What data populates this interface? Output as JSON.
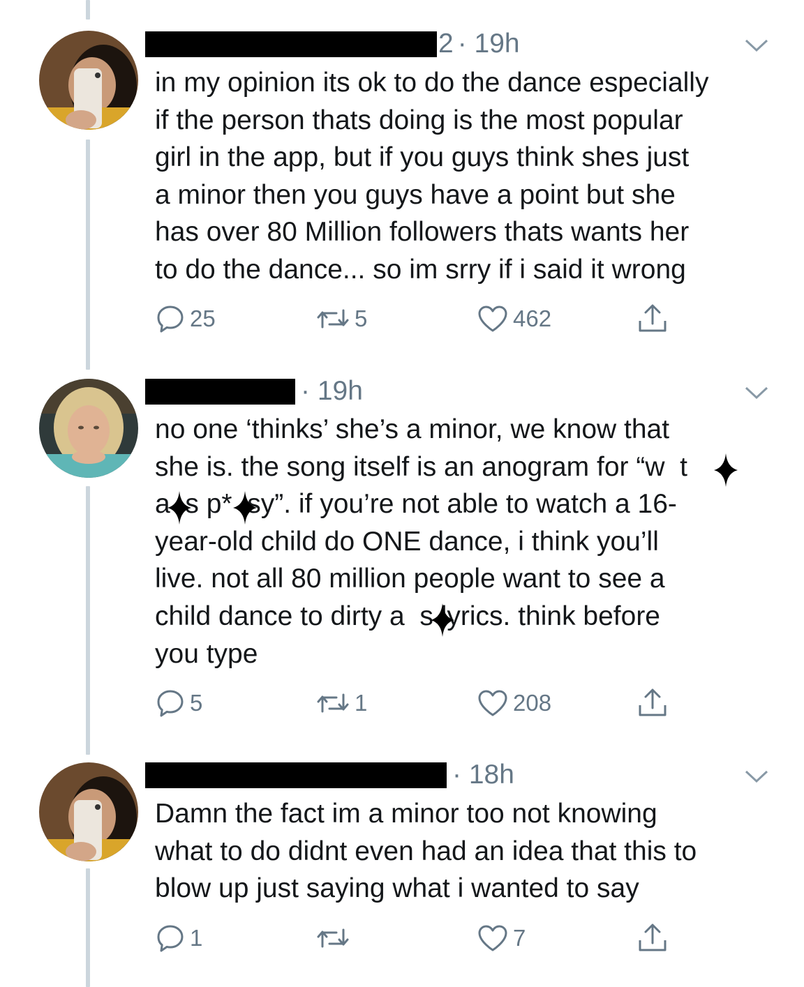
{
  "colors": {
    "text": "#14171a",
    "secondary": "#657786",
    "thread_line": "#ccd6dd",
    "redaction": "#000000"
  },
  "tweets": [
    {
      "author": "redacted",
      "username_tail": "2",
      "time": "· 19h",
      "text": "in my opinion its ok to do the dance especially\nif the person thats doing is the most popular\ngirl in the app, but if you guys think shes just\na minor then you guys have a point but she\nhas over 80 Million followers thats wants her\nto do the dance... so im srry if i said it wrong",
      "replies": "25",
      "retweets": "5",
      "likes": "462",
      "icons": [
        "reply-icon",
        "retweet-icon",
        "like-icon",
        "share-icon",
        "chevron-down-icon"
      ]
    },
    {
      "author": "redacted",
      "username_tail": "",
      "time": "· 19h",
      "text": "no one ‘thinks’ she’s a minor, we know that\nshe is. the song itself is an anogram for “w  t\na  s p*  sy”. if you’re not able to watch a 16-\nyear-old child do ONE dance, i think you’ll\nlive. not all 80 million people want to see a\nchild dance to dirty a  s lyrics. think before\nyou type",
      "replies": "5",
      "retweets": "1",
      "likes": "208",
      "icons": [
        "reply-icon",
        "retweet-icon",
        "like-icon",
        "share-icon",
        "chevron-down-icon",
        "sparkle-censor-icon"
      ]
    },
    {
      "author": "redacted",
      "username_tail": "",
      "time": "· 18h",
      "text": "Damn the fact im a minor too not knowing\nwhat to do didnt even had an idea that this to\nblow up just saying what i wanted to say",
      "replies": "1",
      "retweets": "",
      "likes": "7",
      "icons": [
        "reply-icon",
        "retweet-icon",
        "like-icon",
        "share-icon",
        "chevron-down-icon"
      ]
    }
  ]
}
